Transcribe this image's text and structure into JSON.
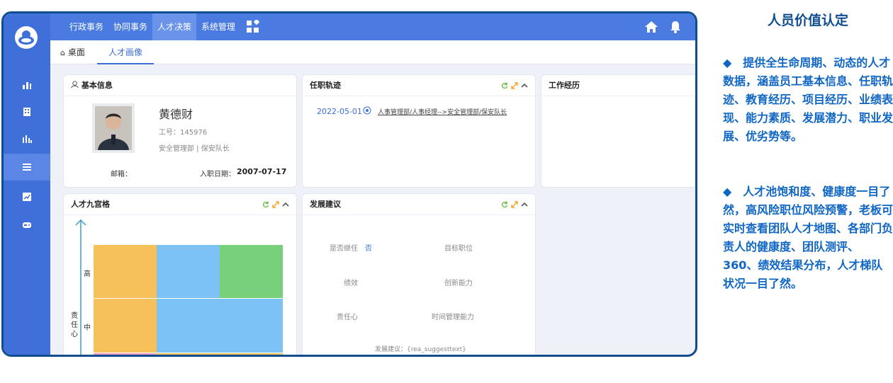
{
  "menu": {
    "items": [
      "行政事务",
      "协同事务",
      "人才决策",
      "系统管理"
    ],
    "active_index": 2
  },
  "tabs": {
    "home": "桌面",
    "active": "人才画像",
    "close": "×"
  },
  "basic_info": {
    "title": "基本信息",
    "name": "黄德财",
    "employee_id": "工号：145976",
    "dept_position": "安全管理部 | 保安队长",
    "email_label": "邮箱：",
    "join_date_label": "入职日期：",
    "join_date": "2007-07-17"
  },
  "career_track": {
    "title": "任职轨迹",
    "date": "2022-05-01",
    "entry": "人事管理部/人事经理-->安全管理部/保安队长"
  },
  "work_history": {
    "title": "工作经历"
  },
  "nine_box": {
    "title": "人才九宫格",
    "y_label": "责任心",
    "levels": [
      "高",
      "中"
    ],
    "colors": {
      "orange": "#f6c15b",
      "blue": "#7cc2f4",
      "green": "#78d07b",
      "pink": "#f09ac4"
    }
  },
  "dev_advice": {
    "title": "发展建议",
    "successor_label": "是否继任",
    "successor_value": "否",
    "target_position": "目标职位",
    "performance": "绩效",
    "innovation": "创新能力",
    "responsibility": "责任心",
    "time_mgmt": "时间管理能力",
    "suggest": "发展建议：{rea_suggesttext}"
  },
  "right_panel": {
    "title": "人员价值认定",
    "para1": "◆　提供全生命周期、动态的人才数据，涵盖员工基本信息、任职轨迹、教育经历、项目经历、业绩表现、能力素质、发展潜力、职业发展、优劣势等。",
    "para2": "◆　人才池饱和度、健康度一目了然，高风险职位风险预警，老板可实时查看团队人才地图、各部门负责人的健康度、团队测评、360、绩效结果分布，人才梯队状况一目了然。"
  },
  "icons": {
    "logo": "logo-icon",
    "home": "home-icon",
    "bell": "bell-icon",
    "grid": "grid-icon",
    "refresh": "refresh-icon",
    "expand": "expand-icon",
    "collapse": "chevron-up-icon",
    "user": "user-icon",
    "radio": "radio-icon"
  }
}
